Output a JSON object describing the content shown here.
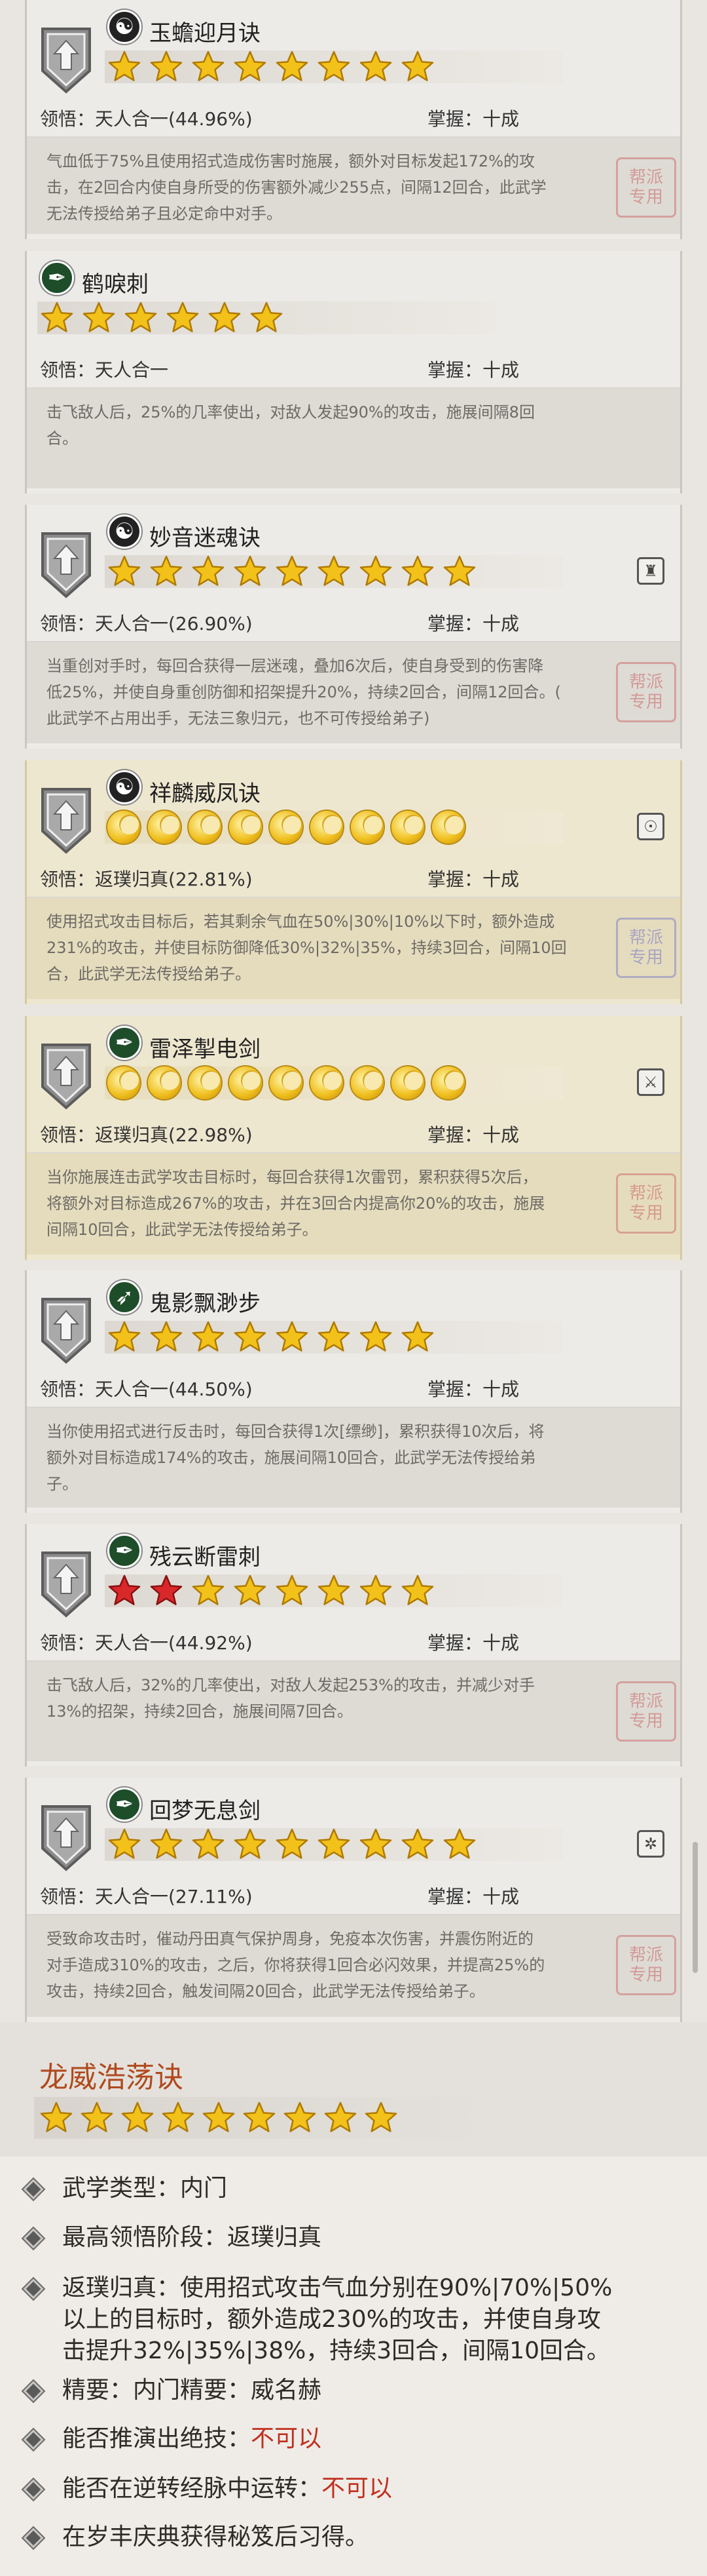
{
  "skills": [
    {
      "title": "玉蟾迎月诀",
      "badge": "☯",
      "rating": "star",
      "count": 8,
      "red": 0,
      "comprehend": "领悟：天人合一(44.96%)",
      "master": "掌握：十成",
      "desc": "气血低于75%且使用招式造成伤害时施展，额外对目标发起172%的攻\n击，在2回合内使自身所受的伤害额外减少255点，间隔12回合，此武学\n无法传授给弟子且必定命中对手。",
      "shield": true,
      "icon": "",
      "seal": "red"
    },
    {
      "title": "鹤唳刺",
      "badge": "剑",
      "rating": "star",
      "count": 6,
      "red": 0,
      "comprehend": "领悟：天人合一",
      "master": "掌握：十成",
      "desc": "击飞敌人后，25%的几率使出，对敌人发起90%的攻击，施展间隔8回\n合。",
      "shield": false,
      "icon": "",
      "seal": ""
    },
    {
      "title": "妙音迷魂诀",
      "badge": "☯",
      "rating": "star",
      "count": 9,
      "red": 0,
      "comprehend": "领悟：天人合一(26.90%)",
      "master": "掌握：十成",
      "desc": "当重创对手时，每回合获得一层迷魂，叠加6次后，使自身受到的伤害降\n低25%，并使自身重创防御和招架提升20%，持续2回合，间隔12回合。(\n此武学不占用出手，无法三象归元，也不可传授给弟子)",
      "shield": true,
      "icon": "♜",
      "seal": "red"
    },
    {
      "title": "祥麟威凤诀",
      "badge": "☯",
      "rating": "moon",
      "count": 9,
      "red": 0,
      "comprehend": "领悟：返璞归真(22.81%)",
      "master": "掌握：十成",
      "desc": "使用招式攻击目标后，若其剩余气血在50%|30%|10%以下时，额外造成\n231%的攻击，并使目标防御降低30%|32%|35%，持续3回合，间隔10回\n合，此武学无法传授给弟子。",
      "shield": true,
      "icon": "☉",
      "seal": "blue",
      "gold": true
    },
    {
      "title": "雷泽掣电剑",
      "badge": "剑",
      "rating": "moon",
      "count": 9,
      "red": 0,
      "comprehend": "领悟：返璞归真(22.98%)",
      "master": "掌握：十成",
      "desc": "当你施展连击武学攻击目标时，每回合获得1次雷罚，累积获得5次后，\n将额外对目标造成267%的攻击，并在3回合内提高你20%的攻击，施展\n间隔10回合，此武学无法传授给弟子。",
      "shield": true,
      "icon": "⚔",
      "seal": "red",
      "gold": true
    },
    {
      "title": "鬼影飘渺步",
      "badge": "步",
      "rating": "star",
      "count": 8,
      "red": 0,
      "comprehend": "领悟：天人合一(44.50%)",
      "master": "掌握：十成",
      "desc": "当你使用招式进行反击时，每回合获得1次[缥缈]，累积获得10次后，将\n额外对目标造成174%的攻击，施展间隔10回合，此武学无法传授给弟\n子。",
      "shield": true,
      "icon": "",
      "seal": ""
    },
    {
      "title": "残云断雷刺",
      "badge": "剑",
      "rating": "star",
      "count": 8,
      "red": 2,
      "comprehend": "领悟：天人合一(44.92%)",
      "master": "掌握：十成",
      "desc": "击飞敌人后，32%的几率使出，对敌人发起253%的攻击，并减少对手\n13%的招架，持续2回合，施展间隔7回合。",
      "shield": true,
      "icon": "",
      "seal": "red"
    },
    {
      "title": "回梦无息剑",
      "badge": "剑",
      "rating": "star",
      "count": 9,
      "red": 0,
      "comprehend": "领悟：天人合一(27.11%)",
      "master": "掌握：十成",
      "desc": "受致命攻击时，催动丹田真气保护周身，免疫本次伤害，并震伤附近的\n对手造成310%的攻击，之后，你将获得1回合必闪效果，并提高25%的\n攻击，持续2回合，触发间隔20回合，此武学无法传授给弟子。",
      "shield": true,
      "icon": "✲",
      "seal": "red"
    }
  ],
  "detail": {
    "title": "龙威浩荡诀",
    "lines": [
      {
        "text": "武学类型：内门"
      },
      {
        "text": "最高领悟阶段：返璞归真"
      },
      {
        "text": "返璞归真：使用招式攻击气血分别在90%|70%|50%\n以上的目标时，额外造成230%的攻击，并使自身攻\n击提升32%|35%|38%，持续3回合，间隔10回合。"
      },
      {
        "text": "精要：内门精要：威名赫"
      },
      {
        "text": "能否推演出绝技：",
        "red": "不可以"
      },
      {
        "text": "能否在逆转经脉中运转：",
        "red": "不可以"
      },
      {
        "text": "在岁丰庆典获得秘笈后习得。"
      }
    ]
  },
  "seal_text": "帮派\n专用",
  "colors": {
    "accent": "#b04a1e",
    "red": "#c0301e"
  }
}
